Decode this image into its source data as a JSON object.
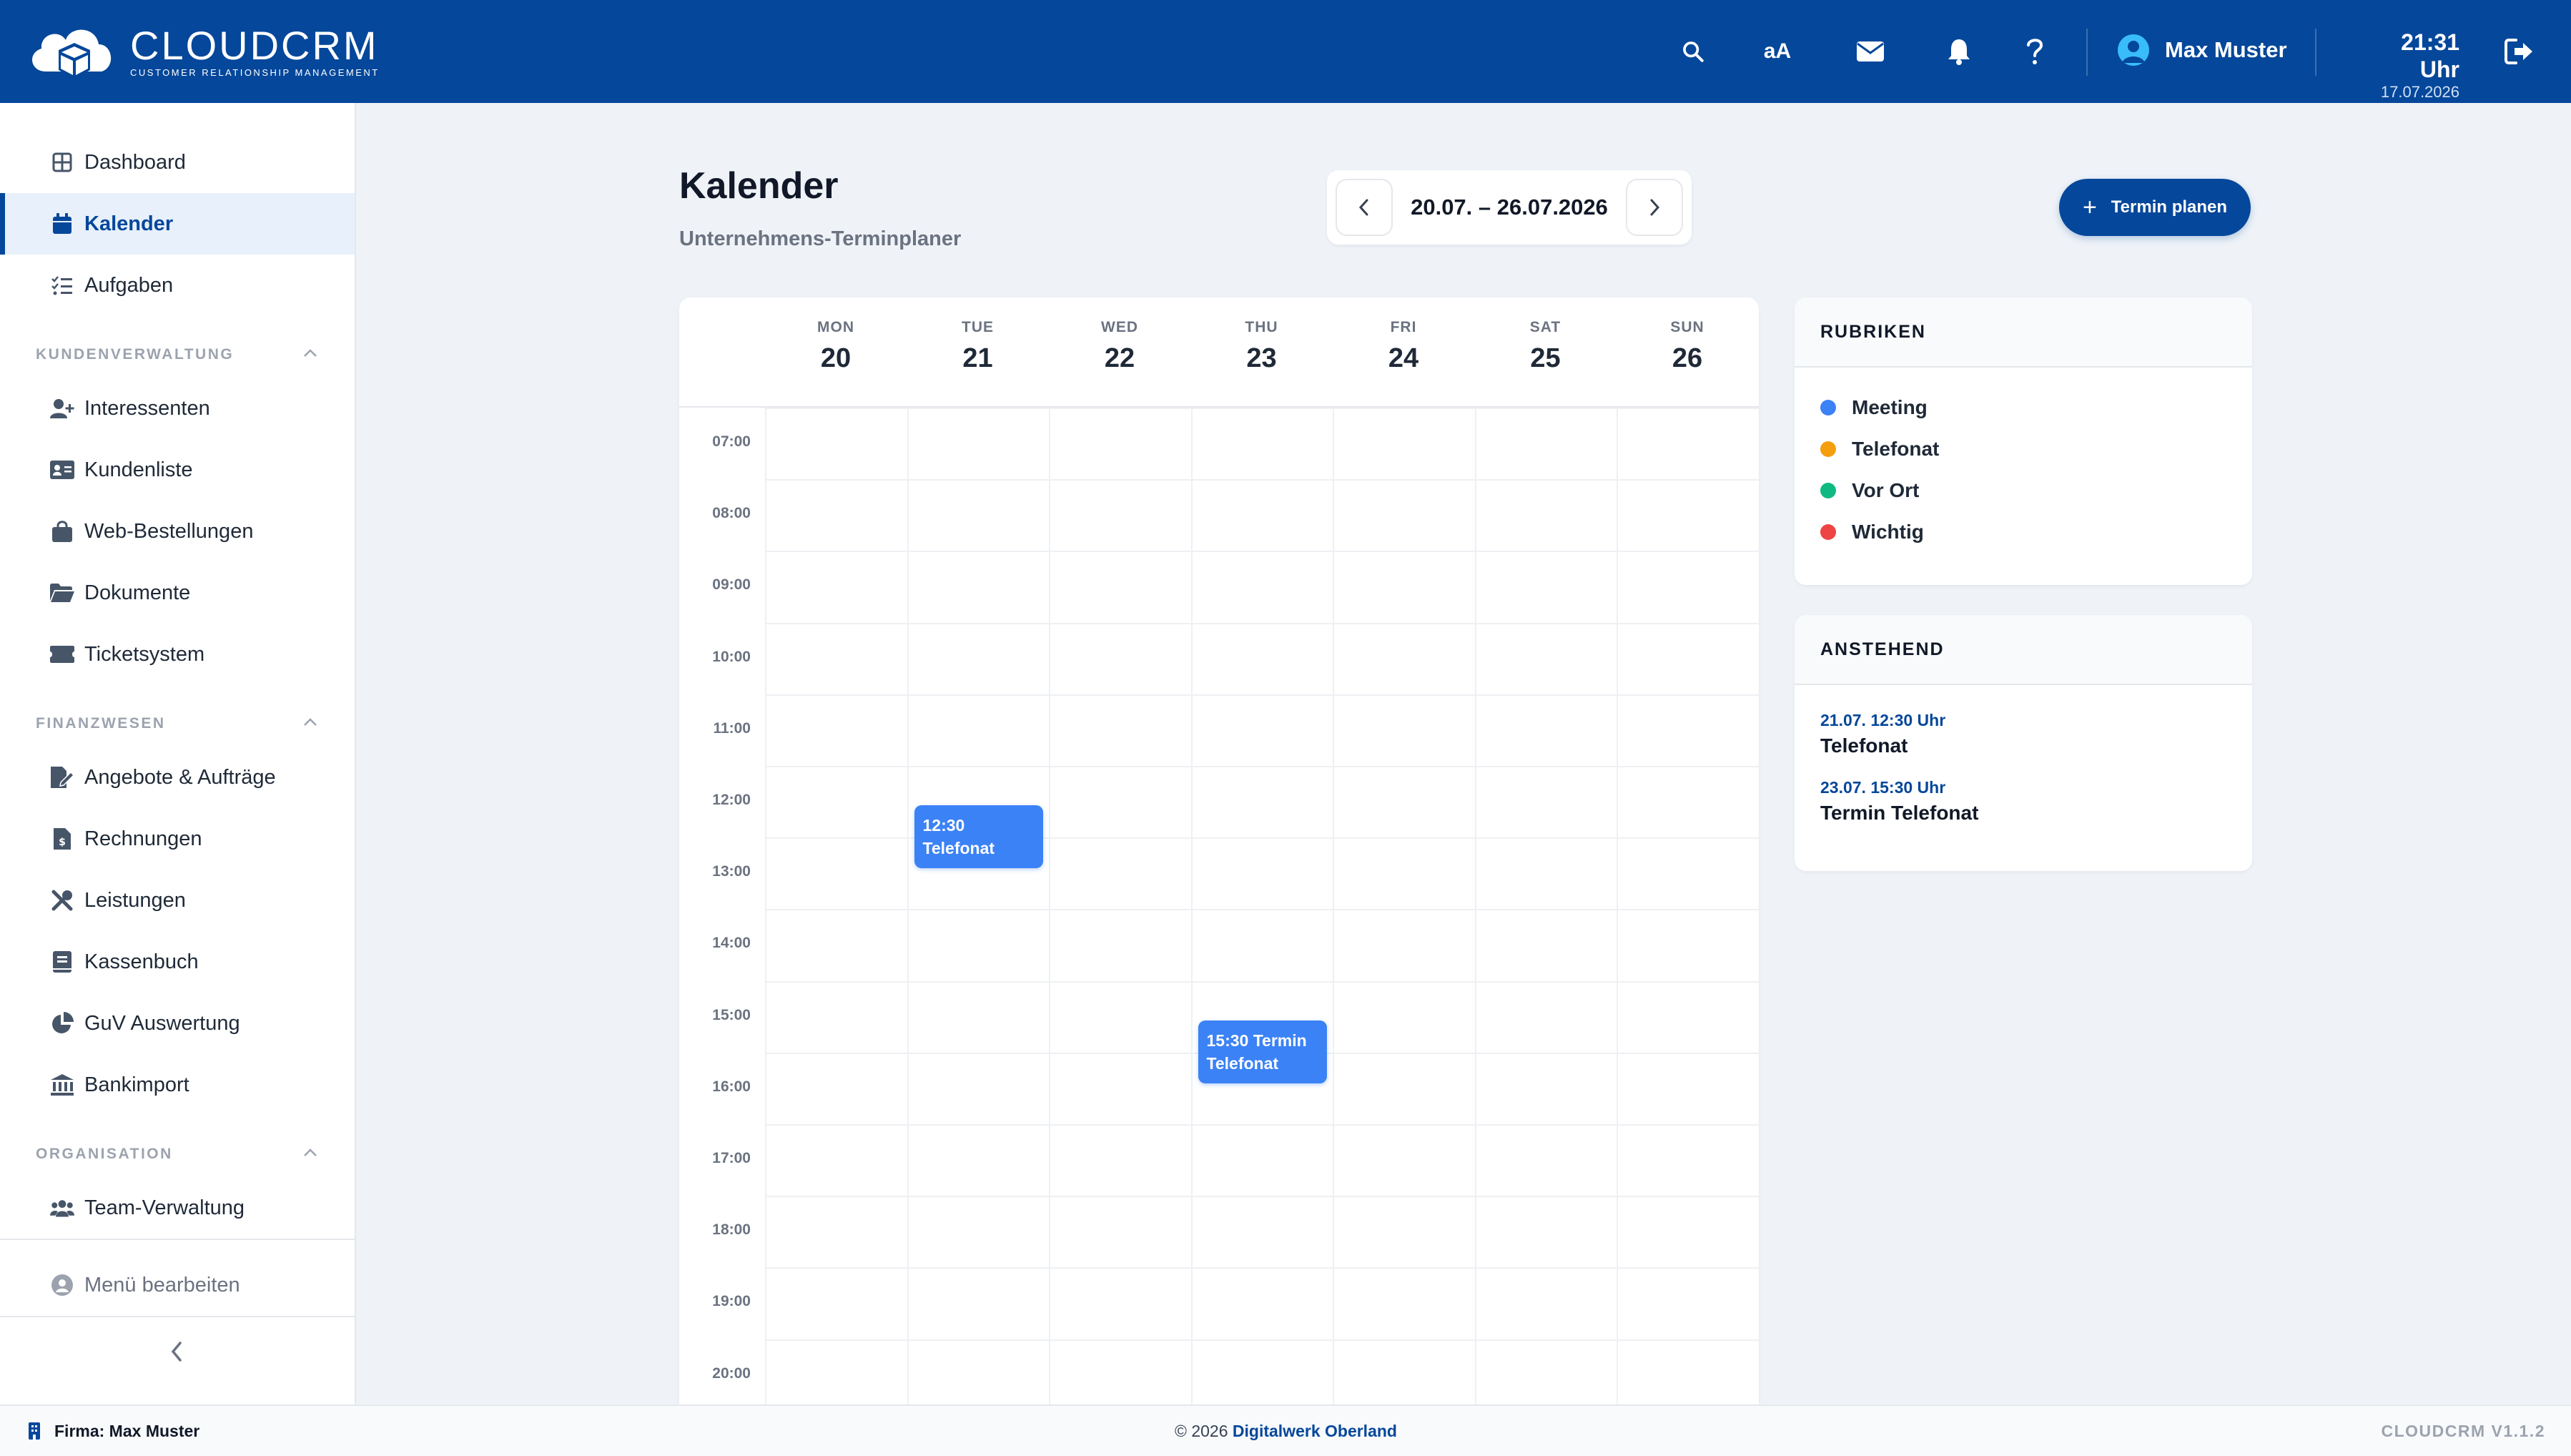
{
  "header": {
    "brand_title": "CLOUDCRM",
    "brand_subtitle": "CUSTOMER RELATIONSHIP MANAGEMENT",
    "font_size_toggle": "aA",
    "user_name": "Max Muster",
    "clock_time": "21:31 Uhr",
    "clock_date": "17.07.2026"
  },
  "sidebar": {
    "top_items": [
      {
        "label": "Dashboard",
        "icon": "grid-icon"
      },
      {
        "label": "Kalender",
        "icon": "calendar-icon",
        "active": true
      },
      {
        "label": "Aufgaben",
        "icon": "task-list-icon"
      }
    ],
    "sections": [
      {
        "label": "KUNDENVERWALTUNG",
        "items": [
          {
            "label": "Interessenten",
            "icon": "user-plus-icon"
          },
          {
            "label": "Kundenliste",
            "icon": "id-card-icon"
          },
          {
            "label": "Web-Bestellungen",
            "icon": "shopping-bag-icon"
          },
          {
            "label": "Dokumente",
            "icon": "folder-icon"
          },
          {
            "label": "Ticketsystem",
            "icon": "ticket-icon"
          }
        ]
      },
      {
        "label": "FINANZWESEN",
        "items": [
          {
            "label": "Angebote & Aufträge",
            "icon": "file-signature-icon"
          },
          {
            "label": "Rechnungen",
            "icon": "invoice-icon"
          },
          {
            "label": "Leistungen",
            "icon": "tools-icon"
          },
          {
            "label": "Kassenbuch",
            "icon": "book-icon"
          },
          {
            "label": "GuV Auswertung",
            "icon": "pie-chart-icon"
          },
          {
            "label": "Bankimport",
            "icon": "bank-icon"
          }
        ]
      },
      {
        "label": "ORGANISATION",
        "items": [
          {
            "label": "Team-Verwaltung",
            "icon": "users-icon"
          }
        ]
      }
    ],
    "edit_menu": "Menü bearbeiten"
  },
  "main": {
    "title": "Kalender",
    "subtitle": "Unternehmens-Terminplaner",
    "week_range": "20.07. – 26.07.2026",
    "plan_button": "Termin planen"
  },
  "calendar": {
    "days": [
      {
        "name": "MON",
        "num": "20"
      },
      {
        "name": "TUE",
        "num": "21"
      },
      {
        "name": "WED",
        "num": "22"
      },
      {
        "name": "THU",
        "num": "23"
      },
      {
        "name": "FRI",
        "num": "24"
      },
      {
        "name": "SAT",
        "num": "25"
      },
      {
        "name": "SUN",
        "num": "26"
      }
    ],
    "hours": [
      "07:00",
      "08:00",
      "09:00",
      "10:00",
      "11:00",
      "12:00",
      "13:00",
      "14:00",
      "15:00",
      "16:00",
      "17:00",
      "18:00",
      "19:00",
      "20:00"
    ],
    "events": [
      {
        "day": "TUE",
        "time": "12:30",
        "text": "12:30 Telefonat",
        "line1": "12:30",
        "line2": "Telefonat",
        "color": "#3b82f6"
      },
      {
        "day": "THU",
        "time": "15:30",
        "text": "15:30 Termin Telefonat",
        "line1": "15:30 Termin",
        "line2": "Telefonat",
        "color": "#3b82f6"
      }
    ]
  },
  "rubriken": {
    "title": "RUBRIKEN",
    "items": [
      {
        "label": "Meeting",
        "color": "#3b82f6"
      },
      {
        "label": "Telefonat",
        "color": "#f59e0b"
      },
      {
        "label": "Vor Ort",
        "color": "#10b981"
      },
      {
        "label": "Wichtig",
        "color": "#ef4444"
      }
    ]
  },
  "anstehend": {
    "title": "ANSTEHEND",
    "items": [
      {
        "time": "21.07. 12:30 Uhr",
        "title": "Telefonat"
      },
      {
        "time": "23.07. 15:30 Uhr",
        "title": "Termin Telefonat"
      }
    ]
  },
  "footer": {
    "firma": "Firma: Max Muster",
    "copyright_prefix": "© 2026 ",
    "copyright_company": "Digitalwerk Oberland",
    "version": "CLOUDCRM V1.1.2"
  },
  "colors": {
    "brand": "#05479a",
    "event": "#3b82f6"
  }
}
